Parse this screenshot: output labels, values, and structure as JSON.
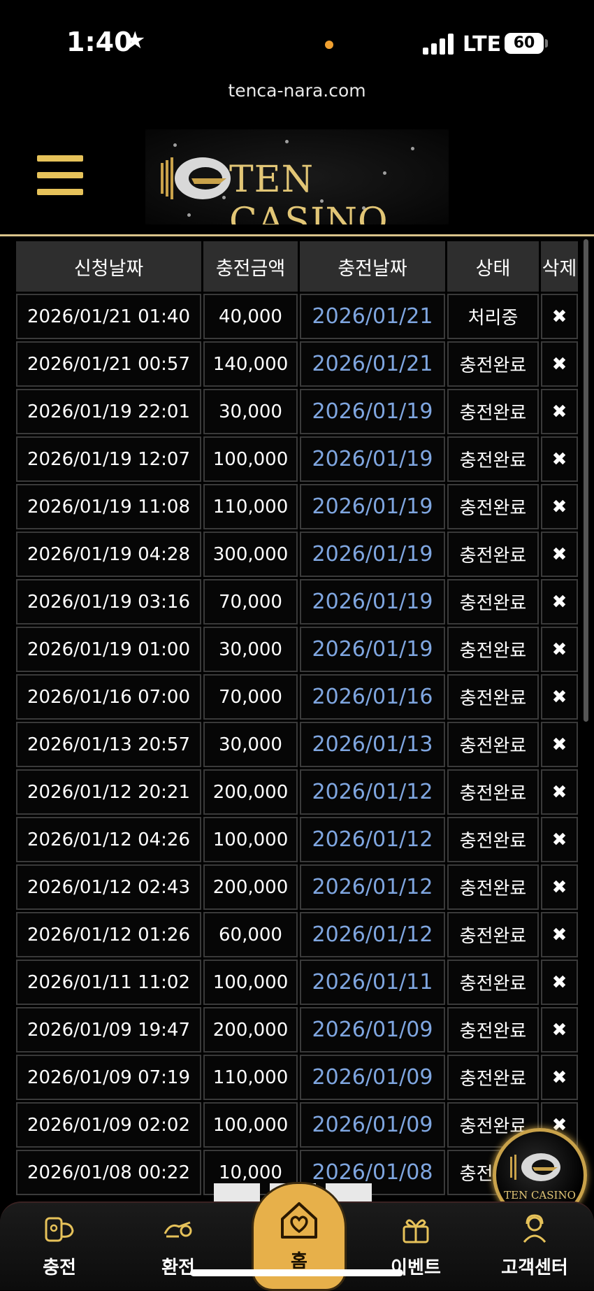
{
  "status_bar": {
    "time": "1:40",
    "network": "LTE",
    "battery": "60"
  },
  "url": "tenca-nara.com",
  "brand": {
    "name": "TEN CASINO",
    "badge_name": "TEN CASINO"
  },
  "table": {
    "headers": [
      "신청날짜",
      "충전금액",
      "충전날짜",
      "상태",
      "삭제"
    ],
    "rows": [
      {
        "requested": "2026/01/21 01:40",
        "amount": "40,000",
        "charged": "2026/01/21",
        "status": "처리중",
        "delete": "✖"
      },
      {
        "requested": "2026/01/21 00:57",
        "amount": "140,000",
        "charged": "2026/01/21",
        "status": "충전완료",
        "delete": "✖"
      },
      {
        "requested": "2026/01/19 22:01",
        "amount": "30,000",
        "charged": "2026/01/19",
        "status": "충전완료",
        "delete": "✖"
      },
      {
        "requested": "2026/01/19 12:07",
        "amount": "100,000",
        "charged": "2026/01/19",
        "status": "충전완료",
        "delete": "✖"
      },
      {
        "requested": "2026/01/19 11:08",
        "amount": "110,000",
        "charged": "2026/01/19",
        "status": "충전완료",
        "delete": "✖"
      },
      {
        "requested": "2026/01/19 04:28",
        "amount": "300,000",
        "charged": "2026/01/19",
        "status": "충전완료",
        "delete": "✖"
      },
      {
        "requested": "2026/01/19 03:16",
        "amount": "70,000",
        "charged": "2026/01/19",
        "status": "충전완료",
        "delete": "✖"
      },
      {
        "requested": "2026/01/19 01:00",
        "amount": "30,000",
        "charged": "2026/01/19",
        "status": "충전완료",
        "delete": "✖"
      },
      {
        "requested": "2026/01/16 07:00",
        "amount": "70,000",
        "charged": "2026/01/16",
        "status": "충전완료",
        "delete": "✖"
      },
      {
        "requested": "2026/01/13 20:57",
        "amount": "30,000",
        "charged": "2026/01/13",
        "status": "충전완료",
        "delete": "✖"
      },
      {
        "requested": "2026/01/12 20:21",
        "amount": "200,000",
        "charged": "2026/01/12",
        "status": "충전완료",
        "delete": "✖"
      },
      {
        "requested": "2026/01/12 04:26",
        "amount": "100,000",
        "charged": "2026/01/12",
        "status": "충전완료",
        "delete": "✖"
      },
      {
        "requested": "2026/01/12 02:43",
        "amount": "200,000",
        "charged": "2026/01/12",
        "status": "충전완료",
        "delete": "✖"
      },
      {
        "requested": "2026/01/12 01:26",
        "amount": "60,000",
        "charged": "2026/01/12",
        "status": "충전완료",
        "delete": "✖"
      },
      {
        "requested": "2026/01/11 11:02",
        "amount": "100,000",
        "charged": "2026/01/11",
        "status": "충전완료",
        "delete": "✖"
      },
      {
        "requested": "2026/01/09 19:47",
        "amount": "200,000",
        "charged": "2026/01/09",
        "status": "충전완료",
        "delete": "✖"
      },
      {
        "requested": "2026/01/09 07:19",
        "amount": "110,000",
        "charged": "2026/01/09",
        "status": "충전완료",
        "delete": "✖"
      },
      {
        "requested": "2026/01/09 02:02",
        "amount": "100,000",
        "charged": "2026/01/09",
        "status": "충전완료",
        "delete": "✖"
      },
      {
        "requested": "2026/01/08 00:22",
        "amount": "10,000",
        "charged": "2026/01/08",
        "status": "충전완료",
        "delete": "✖"
      }
    ]
  },
  "bottom_nav": {
    "deposit": "충전",
    "withdraw": "환전",
    "home": "홈",
    "event": "이벤트",
    "support": "고객센터"
  },
  "colors": {
    "accent_gold": "#e6c25a",
    "date_link": "#7fa6e0",
    "home_button": "#e7b04a"
  }
}
